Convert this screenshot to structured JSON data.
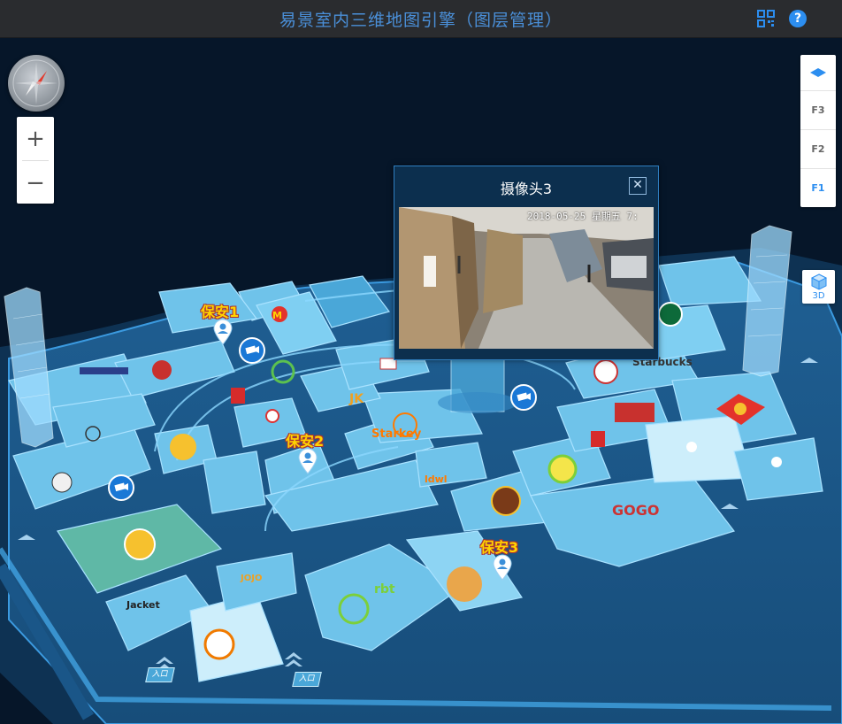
{
  "app": {
    "title": "易景室内三维地图引擎（图层管理）"
  },
  "toolbar": {
    "qr_icon": "qrcode-icon",
    "help_icon": "help-icon",
    "help_label": "?"
  },
  "zoom": {
    "in_label": "+",
    "out_label": "−"
  },
  "floors": {
    "items": [
      "F3",
      "F2",
      "F1"
    ],
    "active": "F1"
  },
  "view_toggle": {
    "label": "3D"
  },
  "popup": {
    "title": "摄像头3",
    "close_label": "✕",
    "timestamp": "2018-05-25 星期五  7:"
  },
  "guards": [
    {
      "label": "保安1"
    },
    {
      "label": "保安2"
    },
    {
      "label": "保安3"
    }
  ],
  "exit_labels": [
    "入口",
    "入口"
  ],
  "colors": {
    "accent": "#2c8ef0",
    "map_bg": "#061629",
    "store": "#6fc3ea",
    "guard_text": "#ffd400"
  }
}
